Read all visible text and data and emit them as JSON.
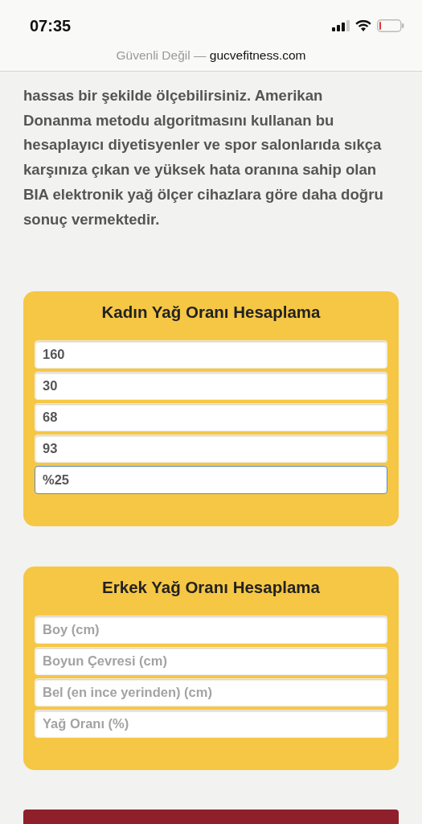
{
  "status_bar": {
    "time": "07:35"
  },
  "address_bar": {
    "security_label": "Güvenli Değil —",
    "domain": "gucvefitness.com"
  },
  "intro_text": "hassas bir şekilde ölçebilirsiniz. Amerikan Donanma metodu algoritmasını kullanan bu hesaplayıcı diyetisyenler ve spor salonlarıda sıkça karşınıza çıkan ve yüksek hata oranına sahip olan BIA elektronik yağ ölçer cihazlara göre daha doğru sonuç vermektedir.",
  "calculators": [
    {
      "title": "Kadın Yağ Oranı Hesaplama",
      "fields": [
        {
          "value": "160",
          "focused": false
        },
        {
          "value": "30",
          "focused": false
        },
        {
          "value": "68",
          "focused": false
        },
        {
          "value": "93",
          "focused": false
        },
        {
          "value": "%25",
          "focused": true
        }
      ]
    },
    {
      "title": "Erkek Yağ Oranı Hesaplama",
      "fields": [
        {
          "placeholder": "Boy (cm)",
          "focused": false
        },
        {
          "placeholder": "Boyun Çevresi (cm)",
          "focused": false
        },
        {
          "placeholder": "Bel (en ince yerinden) (cm)",
          "focused": false
        },
        {
          "placeholder": "Yağ Oranı (%)",
          "focused": false
        }
      ]
    }
  ]
}
